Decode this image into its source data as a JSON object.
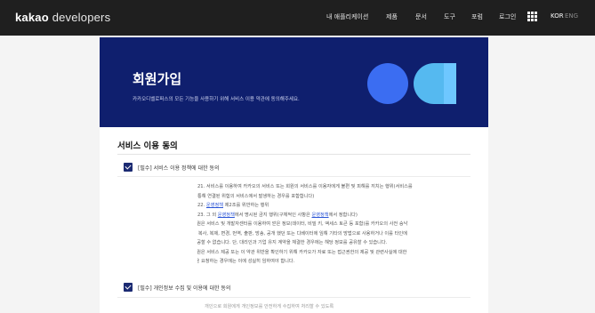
{
  "header": {
    "logo_brand": "kakao",
    "logo_product": "developers",
    "nav": [
      "내 애플리케이션",
      "제품",
      "문서",
      "도구",
      "포럼",
      "로그인"
    ],
    "lang_active": "KOR",
    "lang_inactive": "ENG"
  },
  "banner": {
    "title": "회원가입",
    "subtitle": "카카오디벨로퍼스의 모든 기능을 사용하기 위해 서비스 이용 약관에 동의해주세요."
  },
  "section": {
    "title": "서비스 이용 동의",
    "checkbox1": "[필수] 서비스 이용 정책에 대한 동의",
    "checkbox2": "[필수] 개인정보 수집 및 이용에 대한 동의"
  },
  "terms": {
    "l1": "21. 서비스를 이용하여 카카오의 서비스 또는 회원의 서비스를 이용자에게 불편 및 피해를 끼치는 행위(서비스를",
    "l2": "통해 연결된 위험의 서비스에서 발생하는 경우를 포함합니다)",
    "l3a": "22. ",
    "l3link": "운영정책",
    "l3b": " 제2조를 위반하는 행위",
    "l4a": "23. 그 외 ",
    "l4link": "운영정책",
    "l4b": "에서 명시된 금지 행위(구체적인 사항은 ",
    "l4link2": "운영정책",
    "l4c": "에서 정합니다)",
    "l5": "③ 회원은 서비스 및 개발자센터를 이용하여 얻은 정보(데이터, 비밀 키, 액세스 토큰 등 포함)를 카카오의 사전 승낙",
    "l6": "없이, 복사, 복제, 변경, 번역, 출판, 방송, 공개 했던 또는 디베이터에 임해 기타의 방법으로 사용하거나 이를 타인에",
    "l7": "게 제공할 수 없습니다. 단, 대리인과 기업 유지 계약을 체결한 경우에는 해당 정보를 공유할 수 있습니다.",
    "l8": "④ 회원은 서비스 제공 또는 이 약관 위반을 확인하기 위해 카카오가 자료 또는 접근권한의 제공 및 관련사실에 대한",
    "l9": "소명을 요청하는 경우에는 이에 성실히 임하여야 합니다.",
    "l10": "개인으로 회원에게 개인정보를 안전하게 수집하여 처리할 수 있도록"
  }
}
